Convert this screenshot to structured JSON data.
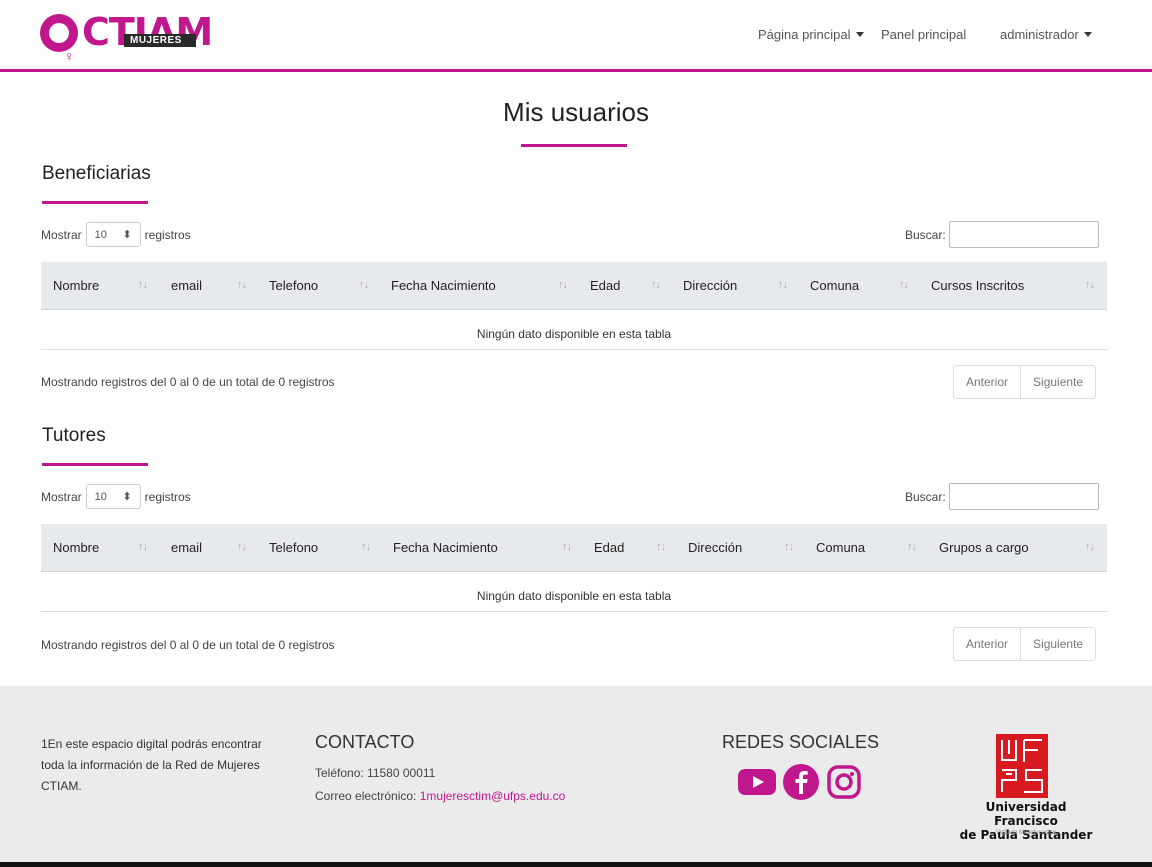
{
  "header": {
    "logo_text": "CTIAM",
    "logo_sub": "MUJERES",
    "nav": {
      "home": "Página principal",
      "panel": "Panel principal",
      "user": "administrador"
    }
  },
  "page_title": "Mis usuarios",
  "tables": [
    {
      "title": "Beneficiarias",
      "length_label_before": "Mostrar",
      "length_value": "10",
      "length_label_after": "registros",
      "search_label": "Buscar:",
      "columns": [
        "Nombre",
        "email",
        "Telefono",
        "Fecha Nacimiento",
        "Edad",
        "Dirección",
        "Comuna",
        "Cursos Inscritos"
      ],
      "empty_text": "Ningún dato disponible en esta tabla",
      "info": "Mostrando registros del 0 al 0 de un total de 0 registros",
      "prev": "Anterior",
      "next": "Siguiente"
    },
    {
      "title": "Tutores",
      "length_label_before": "Mostrar",
      "length_value": "10",
      "length_label_after": "registros",
      "search_label": "Buscar:",
      "columns": [
        "Nombre",
        "email",
        "Telefono",
        "Fecha Nacimiento",
        "Edad",
        "Dirección",
        "Comuna",
        "Grupos a cargo"
      ],
      "empty_text": "Ningún dato disponible en esta tabla",
      "info": "Mostrando registros del 0 al 0 de un total de 0 registros",
      "prev": "Anterior",
      "next": "Siguiente"
    }
  ],
  "footer": {
    "about": "1En este espacio digital podrás encontrar toda la información de la Red de Mujeres CTIAM.",
    "contact_title": "CONTACTO",
    "phone": "Teléfono: 11580 00011",
    "email_label": "Correo electrónico: ",
    "email": "1mujeresctim@ufps.edu.co",
    "social_title": "REDES SOCIALES",
    "social_icons": [
      "youtube-icon",
      "facebook-icon",
      "instagram-icon"
    ],
    "university_line1": "Universidad Francisco",
    "university_line2": "de Paula Santander",
    "university_tag": "Vigilada Mineducación"
  },
  "colors": {
    "accent": "#c0178d",
    "ufps_red": "#d71920",
    "footer_bg": "#ebebeb",
    "thead_bg": "#e7eaed"
  }
}
